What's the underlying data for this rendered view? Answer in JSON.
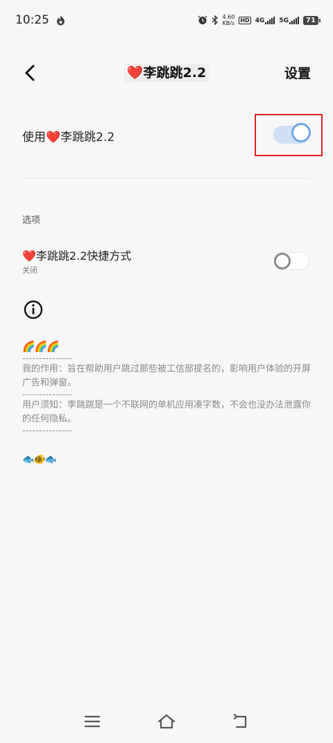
{
  "status_bar": {
    "time": "10:25",
    "speed_value": "4.60",
    "speed_unit": "KB/s",
    "hd_label": "HD",
    "sim1_label": "4G",
    "sim2_label": "5G",
    "battery": "71"
  },
  "header": {
    "heart": "❤️",
    "title": "李跳跳2.2",
    "settings_label": "设置"
  },
  "main_toggle": {
    "prefix": "使用",
    "heart": "❤️",
    "label": "李跳跳2.2",
    "state": "on"
  },
  "options": {
    "section_title": "选项",
    "shortcut": {
      "heart": "❤️",
      "title": "李跳跳2.2快捷方式",
      "subtitle": "关闭",
      "state": "off"
    }
  },
  "description": {
    "rainbows": "🌈🌈🌈",
    "dash_line": "---------------",
    "purpose": "我的作用：旨在帮助用户跳过那些被工信部提名的，影响用户体验的开屏广告和弹窗。",
    "notice": "用户须知：李跳跳是一个不联网的单机应用凑字数，不会也没办法泄露你的任何隐私。",
    "fish": "🐟🐠🐟"
  },
  "colors": {
    "accent": "#6ea6ea",
    "toggle_track_on": "#cfe0f6",
    "highlight": "#e01f1f",
    "background": "#f7f7f7"
  }
}
